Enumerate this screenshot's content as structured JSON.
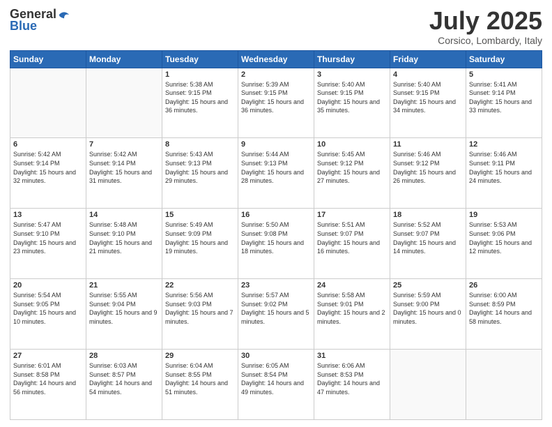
{
  "header": {
    "logo_general": "General",
    "logo_blue": "Blue",
    "month_title": "July 2025",
    "location": "Corsico, Lombardy, Italy"
  },
  "calendar": {
    "days_of_week": [
      "Sunday",
      "Monday",
      "Tuesday",
      "Wednesday",
      "Thursday",
      "Friday",
      "Saturday"
    ],
    "weeks": [
      [
        {
          "day": "",
          "empty": true
        },
        {
          "day": "",
          "empty": true
        },
        {
          "day": "1",
          "sunrise": "Sunrise: 5:38 AM",
          "sunset": "Sunset: 9:15 PM",
          "daylight": "Daylight: 15 hours and 36 minutes."
        },
        {
          "day": "2",
          "sunrise": "Sunrise: 5:39 AM",
          "sunset": "Sunset: 9:15 PM",
          "daylight": "Daylight: 15 hours and 36 minutes."
        },
        {
          "day": "3",
          "sunrise": "Sunrise: 5:40 AM",
          "sunset": "Sunset: 9:15 PM",
          "daylight": "Daylight: 15 hours and 35 minutes."
        },
        {
          "day": "4",
          "sunrise": "Sunrise: 5:40 AM",
          "sunset": "Sunset: 9:15 PM",
          "daylight": "Daylight: 15 hours and 34 minutes."
        },
        {
          "day": "5",
          "sunrise": "Sunrise: 5:41 AM",
          "sunset": "Sunset: 9:14 PM",
          "daylight": "Daylight: 15 hours and 33 minutes."
        }
      ],
      [
        {
          "day": "6",
          "sunrise": "Sunrise: 5:42 AM",
          "sunset": "Sunset: 9:14 PM",
          "daylight": "Daylight: 15 hours and 32 minutes."
        },
        {
          "day": "7",
          "sunrise": "Sunrise: 5:42 AM",
          "sunset": "Sunset: 9:14 PM",
          "daylight": "Daylight: 15 hours and 31 minutes."
        },
        {
          "day": "8",
          "sunrise": "Sunrise: 5:43 AM",
          "sunset": "Sunset: 9:13 PM",
          "daylight": "Daylight: 15 hours and 29 minutes."
        },
        {
          "day": "9",
          "sunrise": "Sunrise: 5:44 AM",
          "sunset": "Sunset: 9:13 PM",
          "daylight": "Daylight: 15 hours and 28 minutes."
        },
        {
          "day": "10",
          "sunrise": "Sunrise: 5:45 AM",
          "sunset": "Sunset: 9:12 PM",
          "daylight": "Daylight: 15 hours and 27 minutes."
        },
        {
          "day": "11",
          "sunrise": "Sunrise: 5:46 AM",
          "sunset": "Sunset: 9:12 PM",
          "daylight": "Daylight: 15 hours and 26 minutes."
        },
        {
          "day": "12",
          "sunrise": "Sunrise: 5:46 AM",
          "sunset": "Sunset: 9:11 PM",
          "daylight": "Daylight: 15 hours and 24 minutes."
        }
      ],
      [
        {
          "day": "13",
          "sunrise": "Sunrise: 5:47 AM",
          "sunset": "Sunset: 9:10 PM",
          "daylight": "Daylight: 15 hours and 23 minutes."
        },
        {
          "day": "14",
          "sunrise": "Sunrise: 5:48 AM",
          "sunset": "Sunset: 9:10 PM",
          "daylight": "Daylight: 15 hours and 21 minutes."
        },
        {
          "day": "15",
          "sunrise": "Sunrise: 5:49 AM",
          "sunset": "Sunset: 9:09 PM",
          "daylight": "Daylight: 15 hours and 19 minutes."
        },
        {
          "day": "16",
          "sunrise": "Sunrise: 5:50 AM",
          "sunset": "Sunset: 9:08 PM",
          "daylight": "Daylight: 15 hours and 18 minutes."
        },
        {
          "day": "17",
          "sunrise": "Sunrise: 5:51 AM",
          "sunset": "Sunset: 9:07 PM",
          "daylight": "Daylight: 15 hours and 16 minutes."
        },
        {
          "day": "18",
          "sunrise": "Sunrise: 5:52 AM",
          "sunset": "Sunset: 9:07 PM",
          "daylight": "Daylight: 15 hours and 14 minutes."
        },
        {
          "day": "19",
          "sunrise": "Sunrise: 5:53 AM",
          "sunset": "Sunset: 9:06 PM",
          "daylight": "Daylight: 15 hours and 12 minutes."
        }
      ],
      [
        {
          "day": "20",
          "sunrise": "Sunrise: 5:54 AM",
          "sunset": "Sunset: 9:05 PM",
          "daylight": "Daylight: 15 hours and 10 minutes."
        },
        {
          "day": "21",
          "sunrise": "Sunrise: 5:55 AM",
          "sunset": "Sunset: 9:04 PM",
          "daylight": "Daylight: 15 hours and 9 minutes."
        },
        {
          "day": "22",
          "sunrise": "Sunrise: 5:56 AM",
          "sunset": "Sunset: 9:03 PM",
          "daylight": "Daylight: 15 hours and 7 minutes."
        },
        {
          "day": "23",
          "sunrise": "Sunrise: 5:57 AM",
          "sunset": "Sunset: 9:02 PM",
          "daylight": "Daylight: 15 hours and 5 minutes."
        },
        {
          "day": "24",
          "sunrise": "Sunrise: 5:58 AM",
          "sunset": "Sunset: 9:01 PM",
          "daylight": "Daylight: 15 hours and 2 minutes."
        },
        {
          "day": "25",
          "sunrise": "Sunrise: 5:59 AM",
          "sunset": "Sunset: 9:00 PM",
          "daylight": "Daylight: 15 hours and 0 minutes."
        },
        {
          "day": "26",
          "sunrise": "Sunrise: 6:00 AM",
          "sunset": "Sunset: 8:59 PM",
          "daylight": "Daylight: 14 hours and 58 minutes."
        }
      ],
      [
        {
          "day": "27",
          "sunrise": "Sunrise: 6:01 AM",
          "sunset": "Sunset: 8:58 PM",
          "daylight": "Daylight: 14 hours and 56 minutes."
        },
        {
          "day": "28",
          "sunrise": "Sunrise: 6:03 AM",
          "sunset": "Sunset: 8:57 PM",
          "daylight": "Daylight: 14 hours and 54 minutes."
        },
        {
          "day": "29",
          "sunrise": "Sunrise: 6:04 AM",
          "sunset": "Sunset: 8:55 PM",
          "daylight": "Daylight: 14 hours and 51 minutes."
        },
        {
          "day": "30",
          "sunrise": "Sunrise: 6:05 AM",
          "sunset": "Sunset: 8:54 PM",
          "daylight": "Daylight: 14 hours and 49 minutes."
        },
        {
          "day": "31",
          "sunrise": "Sunrise: 6:06 AM",
          "sunset": "Sunset: 8:53 PM",
          "daylight": "Daylight: 14 hours and 47 minutes."
        },
        {
          "day": "",
          "empty": true
        },
        {
          "day": "",
          "empty": true
        }
      ]
    ]
  }
}
